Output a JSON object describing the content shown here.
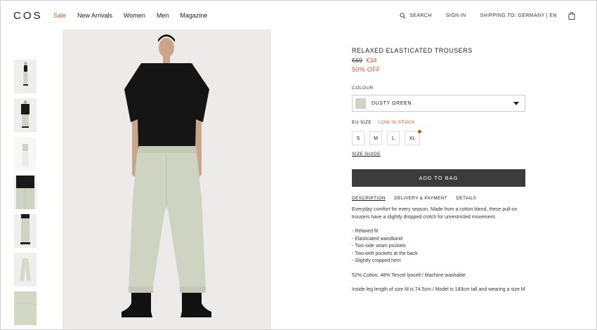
{
  "header": {
    "logo": "COS",
    "nav": [
      "Sale",
      "New Arrivals",
      "Women",
      "Men",
      "Magazine"
    ],
    "search": "SEARCH",
    "sign_in": "SIGN IN",
    "shipping": "SHIPPING TO: GERMANY | EN"
  },
  "product": {
    "title": "RELAXED ELASTICATED TROUSERS",
    "old_price": "€69",
    "new_price": "€34",
    "discount": "50% OFF",
    "colour_label": "COLOUR",
    "colour_name": "DUSTY GREEN",
    "colour_hex": "#cfd4c2",
    "size_label": "EU SIZE",
    "stock_note": "· LOW IN STOCK",
    "sizes": [
      "S",
      "M",
      "L",
      "XL"
    ],
    "size_guide": "SIZE GUIDE",
    "add_to_bag": "ADD TO BAG",
    "tabs": [
      "DESCRIPTION",
      "DELIVERY & PAYMENT",
      "DETAILS"
    ],
    "description": "Everyday comfort for every season. Made from a cotton blend, these pull-on trousers have a slightly dropped crotch for unrestricted movement.",
    "features": [
      "- Relaxed fit",
      "- Elasticated waistband",
      "- Two side seam pockets",
      "- Two welt pockets at the back",
      "- Slightly cropped hem"
    ],
    "composition": "52% Cotton, 48% Tencel lyocell / Machine washable",
    "fit_note": "Inside leg length of size M is 74.5cm / Model is 183cm tall and wearing a size M"
  },
  "colors": {
    "accent": "#c0562c",
    "button": "#3c3c3c",
    "trouser": "#cfd4c2"
  }
}
